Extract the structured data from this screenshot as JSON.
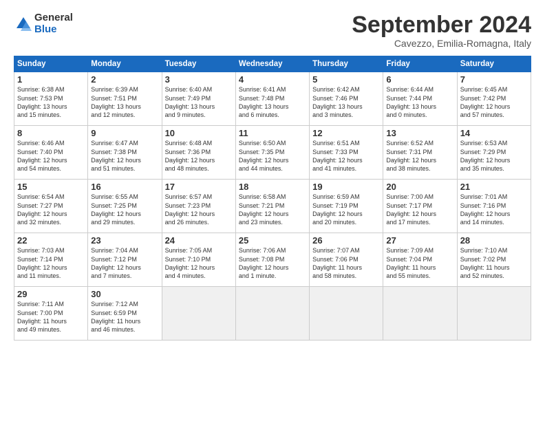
{
  "logo": {
    "general": "General",
    "blue": "Blue"
  },
  "title": "September 2024",
  "location": "Cavezzo, Emilia-Romagna, Italy",
  "weekdays": [
    "Sunday",
    "Monday",
    "Tuesday",
    "Wednesday",
    "Thursday",
    "Friday",
    "Saturday"
  ],
  "weeks": [
    [
      {
        "day": "1",
        "info": "Sunrise: 6:38 AM\nSunset: 7:53 PM\nDaylight: 13 hours\nand 15 minutes."
      },
      {
        "day": "2",
        "info": "Sunrise: 6:39 AM\nSunset: 7:51 PM\nDaylight: 13 hours\nand 12 minutes."
      },
      {
        "day": "3",
        "info": "Sunrise: 6:40 AM\nSunset: 7:49 PM\nDaylight: 13 hours\nand 9 minutes."
      },
      {
        "day": "4",
        "info": "Sunrise: 6:41 AM\nSunset: 7:48 PM\nDaylight: 13 hours\nand 6 minutes."
      },
      {
        "day": "5",
        "info": "Sunrise: 6:42 AM\nSunset: 7:46 PM\nDaylight: 13 hours\nand 3 minutes."
      },
      {
        "day": "6",
        "info": "Sunrise: 6:44 AM\nSunset: 7:44 PM\nDaylight: 13 hours\nand 0 minutes."
      },
      {
        "day": "7",
        "info": "Sunrise: 6:45 AM\nSunset: 7:42 PM\nDaylight: 12 hours\nand 57 minutes."
      }
    ],
    [
      {
        "day": "8",
        "info": "Sunrise: 6:46 AM\nSunset: 7:40 PM\nDaylight: 12 hours\nand 54 minutes."
      },
      {
        "day": "9",
        "info": "Sunrise: 6:47 AM\nSunset: 7:38 PM\nDaylight: 12 hours\nand 51 minutes."
      },
      {
        "day": "10",
        "info": "Sunrise: 6:48 AM\nSunset: 7:36 PM\nDaylight: 12 hours\nand 48 minutes."
      },
      {
        "day": "11",
        "info": "Sunrise: 6:50 AM\nSunset: 7:35 PM\nDaylight: 12 hours\nand 44 minutes."
      },
      {
        "day": "12",
        "info": "Sunrise: 6:51 AM\nSunset: 7:33 PM\nDaylight: 12 hours\nand 41 minutes."
      },
      {
        "day": "13",
        "info": "Sunrise: 6:52 AM\nSunset: 7:31 PM\nDaylight: 12 hours\nand 38 minutes."
      },
      {
        "day": "14",
        "info": "Sunrise: 6:53 AM\nSunset: 7:29 PM\nDaylight: 12 hours\nand 35 minutes."
      }
    ],
    [
      {
        "day": "15",
        "info": "Sunrise: 6:54 AM\nSunset: 7:27 PM\nDaylight: 12 hours\nand 32 minutes."
      },
      {
        "day": "16",
        "info": "Sunrise: 6:55 AM\nSunset: 7:25 PM\nDaylight: 12 hours\nand 29 minutes."
      },
      {
        "day": "17",
        "info": "Sunrise: 6:57 AM\nSunset: 7:23 PM\nDaylight: 12 hours\nand 26 minutes."
      },
      {
        "day": "18",
        "info": "Sunrise: 6:58 AM\nSunset: 7:21 PM\nDaylight: 12 hours\nand 23 minutes."
      },
      {
        "day": "19",
        "info": "Sunrise: 6:59 AM\nSunset: 7:19 PM\nDaylight: 12 hours\nand 20 minutes."
      },
      {
        "day": "20",
        "info": "Sunrise: 7:00 AM\nSunset: 7:17 PM\nDaylight: 12 hours\nand 17 minutes."
      },
      {
        "day": "21",
        "info": "Sunrise: 7:01 AM\nSunset: 7:16 PM\nDaylight: 12 hours\nand 14 minutes."
      }
    ],
    [
      {
        "day": "22",
        "info": "Sunrise: 7:03 AM\nSunset: 7:14 PM\nDaylight: 12 hours\nand 11 minutes."
      },
      {
        "day": "23",
        "info": "Sunrise: 7:04 AM\nSunset: 7:12 PM\nDaylight: 12 hours\nand 7 minutes."
      },
      {
        "day": "24",
        "info": "Sunrise: 7:05 AM\nSunset: 7:10 PM\nDaylight: 12 hours\nand 4 minutes."
      },
      {
        "day": "25",
        "info": "Sunrise: 7:06 AM\nSunset: 7:08 PM\nDaylight: 12 hours\nand 1 minute."
      },
      {
        "day": "26",
        "info": "Sunrise: 7:07 AM\nSunset: 7:06 PM\nDaylight: 11 hours\nand 58 minutes."
      },
      {
        "day": "27",
        "info": "Sunrise: 7:09 AM\nSunset: 7:04 PM\nDaylight: 11 hours\nand 55 minutes."
      },
      {
        "day": "28",
        "info": "Sunrise: 7:10 AM\nSunset: 7:02 PM\nDaylight: 11 hours\nand 52 minutes."
      }
    ],
    [
      {
        "day": "29",
        "info": "Sunrise: 7:11 AM\nSunset: 7:00 PM\nDaylight: 11 hours\nand 49 minutes."
      },
      {
        "day": "30",
        "info": "Sunrise: 7:12 AM\nSunset: 6:59 PM\nDaylight: 11 hours\nand 46 minutes."
      },
      {
        "day": "",
        "info": ""
      },
      {
        "day": "",
        "info": ""
      },
      {
        "day": "",
        "info": ""
      },
      {
        "day": "",
        "info": ""
      },
      {
        "day": "",
        "info": ""
      }
    ]
  ]
}
